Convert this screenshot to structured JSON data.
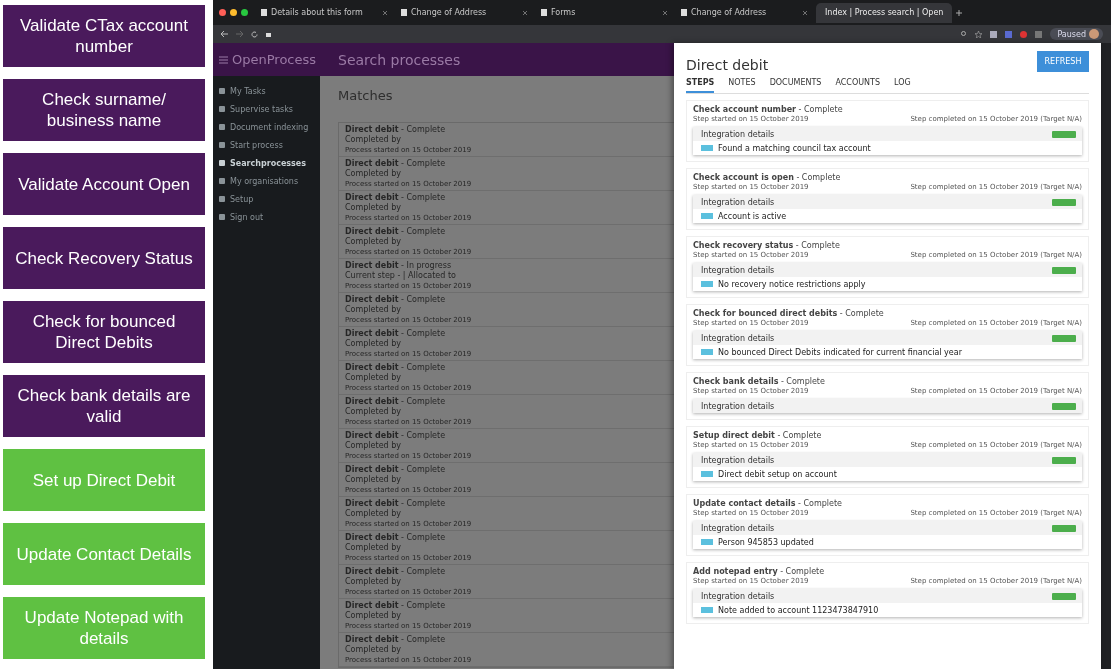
{
  "steps_legend": [
    {
      "label": "Validate CTax account number",
      "color": "#4a1a5c"
    },
    {
      "label": "Check surname/ business name",
      "color": "#4a1a5c"
    },
    {
      "label": "Validate Account Open",
      "color": "#4a1a5c"
    },
    {
      "label": "Check Recovery Status",
      "color": "#4a1a5c"
    },
    {
      "label": "Check for bounced Direct Debits",
      "color": "#4a1a5c"
    },
    {
      "label": "Check bank details are valid",
      "color": "#4a1a5c"
    },
    {
      "label": "Set up Direct Debit",
      "color": "#5fc142"
    },
    {
      "label": "Update Contact Details",
      "color": "#5fc142"
    },
    {
      "label": "Update Notepad with details",
      "color": "#5fc142"
    }
  ],
  "browser": {
    "tabs": [
      {
        "title": "Details about this form",
        "selected": false
      },
      {
        "title": "Change of Address",
        "selected": false
      },
      {
        "title": "Forms",
        "selected": false
      },
      {
        "title": "Change of Address",
        "selected": false
      },
      {
        "title": "Index | Process search | Open",
        "selected": true
      }
    ],
    "profile": "Paused"
  },
  "app": {
    "brand": "OpenProcess",
    "page_title": "Search processes",
    "sidebar": [
      {
        "label": "My Tasks",
        "selected": false
      },
      {
        "label": "Supervise tasks",
        "selected": false
      },
      {
        "label": "Document indexing",
        "selected": false
      },
      {
        "label": "Start process",
        "selected": false
      },
      {
        "label": "Searchprocesses",
        "selected": true
      },
      {
        "label": "My organisations",
        "selected": false
      },
      {
        "label": "Setup",
        "selected": false
      },
      {
        "label": "Sign out",
        "selected": false
      }
    ],
    "matches_title": "Matches",
    "matches": [
      {
        "title": "**Direct debit** - Complete",
        "line2": "Completed by",
        "line3": "Process started on 15 October 2019"
      },
      {
        "title": "**Direct debit** - Complete",
        "line2": "Completed by",
        "line3": "Process started on 15 October 2019"
      },
      {
        "title": "**Direct debit** - Complete",
        "line2": "Completed by",
        "line3": "Process started on 15 October 2019"
      },
      {
        "title": "**Direct debit** - Complete",
        "line2": "Completed by",
        "line3": "Process started on 15 October 2019"
      },
      {
        "title": "**Direct debit** - In progress",
        "line2": "Current step - | Allocated to",
        "line3": "Process started on 15 October 2019"
      },
      {
        "title": "**Direct debit** - Complete",
        "line2": "Completed by",
        "line3": "Process started on 15 October 2019"
      },
      {
        "title": "**Direct debit** - Complete",
        "line2": "Completed by",
        "line3": "Process started on 15 October 2019"
      },
      {
        "title": "**Direct debit** - Complete",
        "line2": "Completed by",
        "line3": "Process started on 15 October 2019"
      },
      {
        "title": "**Direct debit** - Complete",
        "line2": "Completed by",
        "line3": "Process started on 15 October 2019"
      },
      {
        "title": "**Direct debit** - Complete",
        "line2": "Completed by",
        "line3": "Process started on 15 October 2019"
      },
      {
        "title": "**Direct debit** - Complete",
        "line2": "Completed by",
        "line3": "Process started on 15 October 2019"
      },
      {
        "title": "**Direct debit** - Complete",
        "line2": "Completed by",
        "line3": "Process started on 15 October 2019"
      },
      {
        "title": "**Direct debit** - Complete",
        "line2": "Completed by",
        "line3": "Process started on 15 October 2019"
      },
      {
        "title": "**Direct debit** - Complete",
        "line2": "Completed by",
        "line3": "Process started on 15 October 2019"
      },
      {
        "title": "**Direct debit** - Complete",
        "line2": "Completed by",
        "line3": "Process started on 15 October 2019"
      },
      {
        "title": "**Direct debit** - Complete",
        "line2": "Completed by",
        "line3": "Process started on 15 October 2019"
      }
    ],
    "detail": {
      "title": "Direct debit",
      "refresh": "REFRESH",
      "tabs": [
        {
          "label": "STEPS",
          "selected": true
        },
        {
          "label": "NOTES",
          "selected": false
        },
        {
          "label": "DOCUMENTS",
          "selected": false
        },
        {
          "label": "ACCOUNTS",
          "selected": false
        },
        {
          "label": "LOG",
          "selected": false
        }
      ],
      "steps": [
        {
          "title": "**Check account number** - Complete",
          "started": "Step started on 15 October 2019",
          "completed": "Step completed on 15 October 2019 (Target N/A)",
          "integration": "Integration details",
          "message": "Found a matching council tax account"
        },
        {
          "title": "**Check account is open** - Complete",
          "started": "Step started on 15 October 2019",
          "completed": "Step completed on 15 October 2019 (Target N/A)",
          "integration": "Integration details",
          "message": "Account is active"
        },
        {
          "title": "**Check recovery status** - Complete",
          "started": "Step started on 15 October 2019",
          "completed": "Step completed on 15 October 2019 (Target N/A)",
          "integration": "Integration details",
          "message": "No recovery notice restrictions apply"
        },
        {
          "title": "**Check for bounced direct debits** - Complete",
          "started": "Step started on 15 October 2019",
          "completed": "Step completed on 15 October 2019 (Target N/A)",
          "integration": "Integration details",
          "message": "No bounced Direct Debits indicated for current financial year"
        },
        {
          "title": "**Check bank details** - Complete",
          "started": "Step started on 15 October 2019",
          "completed": "Step completed on 15 October 2019 (Target N/A)",
          "integration": "Integration details"
        },
        {
          "title": "**Setup direct debit** - Complete",
          "started": "Step started on 15 October 2019",
          "completed": "Step completed on 15 October 2019 (Target N/A)",
          "integration": "Integration details",
          "message": "Direct debit setup on account"
        },
        {
          "title": "**Update contact details** - Complete",
          "started": "Step started on 15 October 2019",
          "completed": "Step completed on 15 October 2019 (Target N/A)",
          "integration": "Integration details",
          "message": "Person 945853 updated"
        },
        {
          "title": "**Add notepad entry** - Complete",
          "started": "Step started on 15 October 2019",
          "completed": "Step completed on 15 October 2019 (Target N/A)",
          "integration": "Integration details",
          "message": "Note added to account 1123473847910"
        }
      ]
    }
  }
}
